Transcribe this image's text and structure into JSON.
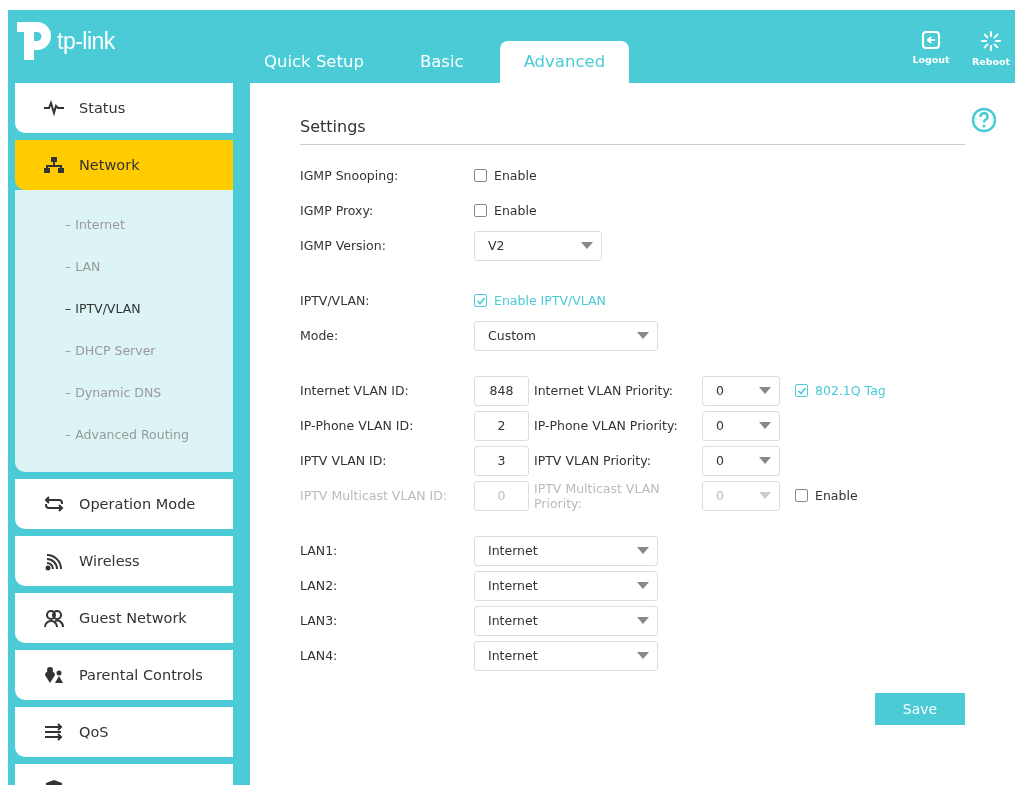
{
  "header": {
    "logo": "tp-link",
    "tabs": [
      {
        "label": "Quick Setup",
        "selected": false
      },
      {
        "label": "Basic",
        "selected": false
      },
      {
        "label": "Advanced",
        "selected": true
      }
    ],
    "actions": [
      {
        "label": "Logout",
        "kind": "logout"
      },
      {
        "label": "Reboot",
        "kind": "reboot"
      }
    ]
  },
  "sidebar": {
    "items": [
      {
        "label": "Status",
        "selected": false
      },
      {
        "label": "Network",
        "selected": true,
        "children": [
          {
            "label": "– Internet",
            "selected": false
          },
          {
            "label": "– LAN",
            "selected": false
          },
          {
            "label": "– IPTV/VLAN",
            "selected": true
          },
          {
            "label": "– DHCP Server",
            "selected": false
          },
          {
            "label": "– Dynamic DNS",
            "selected": false
          },
          {
            "label": "– Advanced Routing",
            "selected": false
          }
        ]
      },
      {
        "label": "Operation Mode",
        "selected": false
      },
      {
        "label": "Wireless",
        "selected": false
      },
      {
        "label": "Guest Network",
        "selected": false
      },
      {
        "label": "Parental Controls",
        "selected": false
      },
      {
        "label": "QoS",
        "selected": false
      },
      {
        "selected": false
      }
    ]
  },
  "settings": {
    "title": "Settings",
    "sections": [
      [
        {
          "kind": "checkbox",
          "label": "IGMP Snooping:",
          "option": "Enable",
          "checked": false
        },
        {
          "kind": "checkbox",
          "label": "IGMP Proxy:",
          "option": "Enable",
          "checked": false
        },
        {
          "kind": "short-select",
          "label": "IGMP Version:",
          "value": "V2"
        }
      ],
      [
        {
          "kind": "checkbox",
          "label": "IPTV/VLAN:",
          "option": "Enable IPTV/VLAN",
          "checked": true
        },
        {
          "kind": "select",
          "label": "Mode:",
          "value": "Custom"
        }
      ],
      [
        {
          "kind": "vlan",
          "label": "Internet VLAN ID:",
          "id": "848",
          "priority_label": "Internet VLAN Priority:",
          "priority": "0",
          "disabled": false,
          "tag": {
            "label": "802.1Q Tag",
            "checked": true
          }
        },
        {
          "kind": "vlan",
          "label": "IP-Phone VLAN ID:",
          "id": "2",
          "priority_label": "IP-Phone VLAN Priority:",
          "priority": "0",
          "disabled": false
        },
        {
          "kind": "vlan",
          "label": "IPTV VLAN ID:",
          "id": "3",
          "priority_label": "IPTV VLAN Priority:",
          "priority": "0",
          "disabled": false
        },
        {
          "kind": "vlan",
          "label": "IPTV Multicast VLAN ID:",
          "id": "0",
          "priority_label": "IPTV Multicast VLAN Priority:",
          "priority": "0",
          "disabled": true,
          "tag": {
            "label": "Enable",
            "checked": false
          }
        }
      ],
      [
        {
          "kind": "select",
          "label": "LAN1:",
          "value": "Internet"
        },
        {
          "kind": "select",
          "label": "LAN2:",
          "value": "Internet"
        },
        {
          "kind": "select",
          "label": "LAN3:",
          "value": "Internet"
        },
        {
          "kind": "select",
          "label": "LAN4:",
          "value": "Internet"
        }
      ]
    ],
    "save": "Save"
  }
}
